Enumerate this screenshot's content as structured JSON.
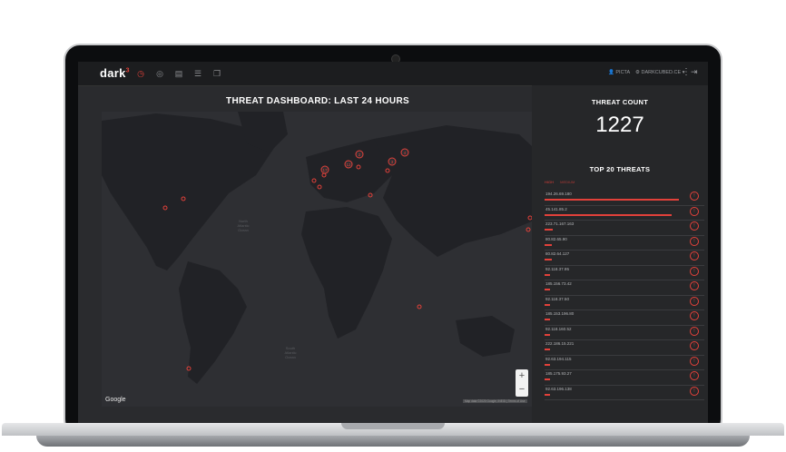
{
  "topbar": {
    "logo": "dark",
    "logo_sup": "3",
    "icons": [
      "dashboard-icon",
      "globe-icon",
      "document-icon",
      "sliders-icon",
      "copy-icon"
    ],
    "user": "PICTA",
    "org": "DARKCUBED.CE",
    "menu_glyph": "⋮",
    "logout_glyph": "⇥"
  },
  "main": {
    "title": "THREAT DASHBOARD: LAST 24 HOURS"
  },
  "map": {
    "labels": {
      "north_atlantic": "North\nAtlantic\nOcean",
      "south_atlantic": "South\nAtlantic\nOcean"
    },
    "clusters": [
      "2",
      "3",
      "4",
      "12",
      "17"
    ],
    "zoom_in": "+",
    "zoom_out": "−",
    "google": "Google",
    "attribution": "Map data ©2020 Google, INEGI | Terms of Use"
  },
  "side": {
    "threat_count_title": "THREAT COUNT",
    "threat_count": "1227",
    "top20_title": "TOP 20 THREATS",
    "legend": {
      "high": "HIGH",
      "medium": "MEDIUM"
    },
    "threats": [
      {
        "ip": "194.26.69.180",
        "level": 0.95
      },
      {
        "ip": "45.141.85.2",
        "level": 0.9
      },
      {
        "ip": "223.71.167.163",
        "level": 0.06
      },
      {
        "ip": "80.82.65.90",
        "level": 0.05
      },
      {
        "ip": "80.82.64.127",
        "level": 0.05
      },
      {
        "ip": "92.118.37.95",
        "level": 0.04
      },
      {
        "ip": "185.156.73.42",
        "level": 0.04
      },
      {
        "ip": "92.118.37.50",
        "level": 0.04
      },
      {
        "ip": "185.153.196.80",
        "level": 0.04
      },
      {
        "ip": "92.118.160.52",
        "level": 0.04
      },
      {
        "ip": "222.186.15.221",
        "level": 0.04
      },
      {
        "ip": "92.63.194.115",
        "level": 0.04
      },
      {
        "ip": "185.175.93.27",
        "level": 0.04
      },
      {
        "ip": "92.63.196.138",
        "level": 0.04
      }
    ]
  },
  "colors": {
    "accent": "#e2413a",
    "panel": "#262729",
    "topbar": "#1c1d1f"
  }
}
